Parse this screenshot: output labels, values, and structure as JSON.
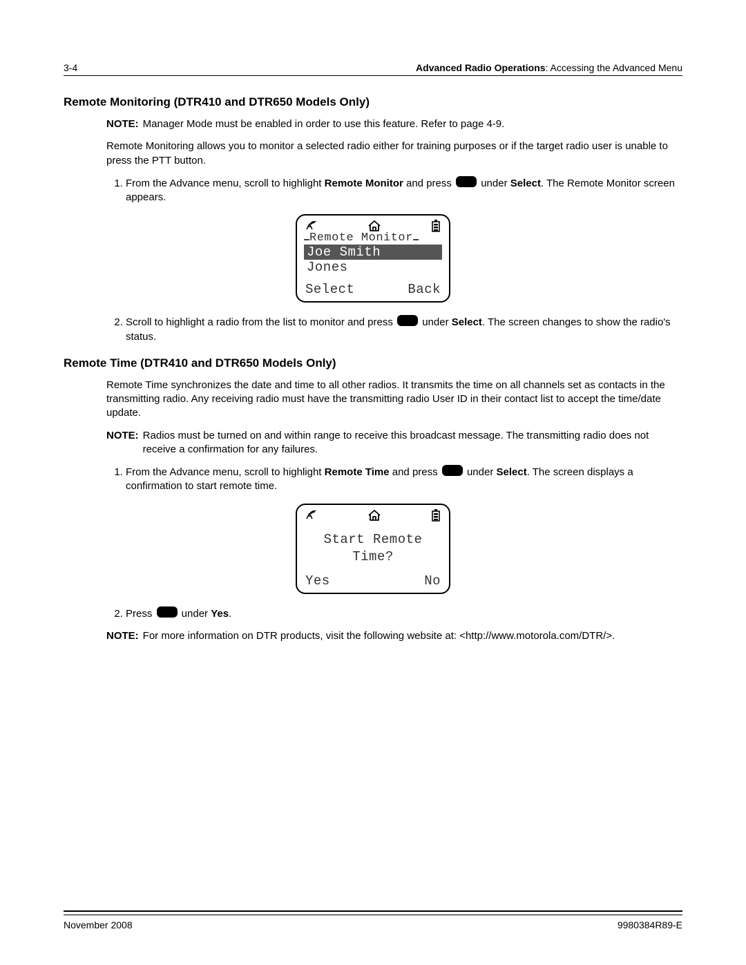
{
  "header": {
    "page_number": "3-4",
    "chapter_bold": "Advanced Radio Operations",
    "chapter_rest": ": Accessing the Advanced Menu"
  },
  "section1": {
    "heading": "Remote Monitoring (DTR410 and DTR650 Models Only)",
    "note_label": "NOTE:",
    "note_text": "Manager Mode must be enabled in order to use this feature. Refer to page 4-9.",
    "intro": "Remote Monitoring allows you to monitor a selected radio either for training purposes or if the target radio user is unable to press the PTT button.",
    "step1_a": "From the Advance menu, scroll to highlight ",
    "step1_bold1": "Remote Monitor",
    "step1_b": " and press ",
    "step1_c": " under ",
    "step1_bold2": "Select",
    "step1_d": ". The Remote Monitor screen appears.",
    "step2_a": "Scroll to highlight a radio from the list to monitor and press ",
    "step2_b": " under ",
    "step2_bold": "Select",
    "step2_c": ". The screen changes to show the radio's status."
  },
  "lcd1": {
    "title": "Remote Monitor",
    "item_selected": "Joe Smith",
    "item2": "Jones",
    "soft_left": "Select",
    "soft_right": "Back"
  },
  "section2": {
    "heading": "Remote Time (DTR410 and DTR650 Models Only)",
    "intro": "Remote Time synchronizes the date and time to all other radios. It transmits the time on all channels set as contacts in the transmitting radio. Any receiving radio must have the transmitting radio User ID in their contact list to accept the time/date update.",
    "note_label": "NOTE:",
    "note_text": "Radios must be turned on and within range to receive this broadcast message. The transmitting radio does not receive a confirmation for any failures.",
    "step1_a": "From the Advance menu, scroll to highlight ",
    "step1_bold1": "Remote Time",
    "step1_b": " and press ",
    "step1_c": " under ",
    "step1_bold2": "Select",
    "step1_d": ". The screen displays a confirmation to start remote time.",
    "step2_a": "Press ",
    "step2_b": " under ",
    "step2_bold": "Yes",
    "step2_c": ".",
    "note2_label": "NOTE:",
    "note2_text": "For more information on DTR products, visit the following website at: <http://www.motorola.com/DTR/>."
  },
  "lcd2": {
    "line1": "Start Remote",
    "line2": "Time?",
    "soft_left": "Yes",
    "soft_right": "No"
  },
  "footer": {
    "date": "November 2008",
    "docnum": "9980384R89-E"
  }
}
